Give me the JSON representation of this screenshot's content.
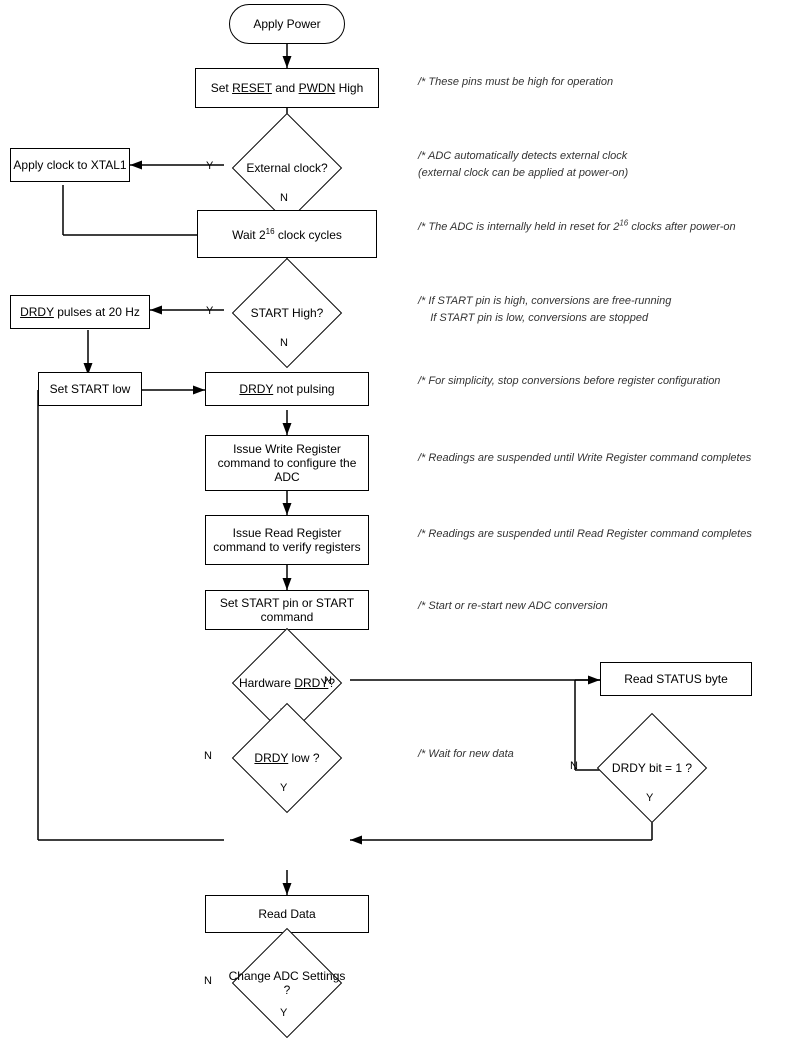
{
  "nodes": {
    "apply_power": {
      "label": "Apply Power"
    },
    "set_reset": {
      "label": "Set RESET and PWDN High"
    },
    "external_clock_q": {
      "label": "External clock?"
    },
    "apply_clock": {
      "label": "Apply clock to XTAL1"
    },
    "wait_cycles": {
      "label": "Wait 2<sup>16</sup> clock cycles"
    },
    "start_high_q": {
      "label": "START High?"
    },
    "drdy_pulses": {
      "label": "DRDY pulses at 20 Hz"
    },
    "set_start_low": {
      "label": "Set START low"
    },
    "drdy_not_pulsing": {
      "label": "DRDY not pulsing"
    },
    "write_register": {
      "label": "Issue Write Register command to configure the ADC"
    },
    "read_register": {
      "label": "Issue Read Register command to verify registers"
    },
    "set_start_pin": {
      "label": "Set START pin or START command"
    },
    "hardware_drdy_q": {
      "label": "Hardware DRDY?"
    },
    "drdy_low_q": {
      "label": "DRDY low ?"
    },
    "read_data": {
      "label": "Read Data"
    },
    "change_adc_q": {
      "label": "Change ADC Settings ?"
    },
    "read_status": {
      "label": "Read STATUS byte"
    },
    "drdy_bit_q": {
      "label": "DRDY bit = 1 ?"
    }
  },
  "comments": {
    "c1": "/* These pins must be high for operation",
    "c2": "/* ADC automatically detects external clock\n(external clock can be applied at power-on)",
    "c3": "/* The ADC is internally held in reset for 2¹⁶ clocks after power-on",
    "c4": "/* If START pin is high, conversions are free-running\n    If START pin is low, conversions are stopped",
    "c5": "/* For simplicity, stop conversions before register configuration",
    "c6": "/* Readings are suspended until Write Register command completes",
    "c7": "/* Readings are suspended until Read Register command completes",
    "c8": "/* Start or re-start new ADC conversion",
    "c9": "/* Wait for new data"
  },
  "labels": {
    "y": "Y",
    "n": "N"
  }
}
